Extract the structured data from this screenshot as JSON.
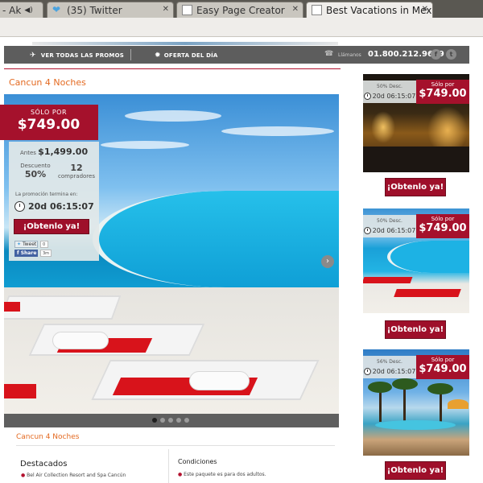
{
  "browser": {
    "tabs": [
      {
        "label": "- Ak",
        "icon": "speaker-icon"
      },
      {
        "label": "(35) Twitter",
        "icon": "twitter-icon"
      },
      {
        "label": "Easy Page Creator",
        "icon": "page-icon"
      },
      {
        "label": "Best Vacations in Mex",
        "icon": "page-icon"
      }
    ]
  },
  "nav": {
    "promos": "VER TODAS LAS PROMOS",
    "deal": "OFERTA DEL DÍA",
    "call_label": "Llámanos",
    "phone": "01.800.212.9639",
    "social": [
      "f",
      "t"
    ]
  },
  "main": {
    "title": "Cancun 4 Noches",
    "price_label": "SÓLO POR",
    "price": "$749.00",
    "before_label": "Antes",
    "before_price": "$1,499.00",
    "discount_label": "Descuento",
    "discount": "50%",
    "buyers_count": "12",
    "buyers_label": "compradores",
    "ends_label": "La promoción termina en:",
    "timer": "20d 06:15:07",
    "cta": "¡Obtenlo ya!",
    "tweet": "Tweet",
    "tweet_count": "0",
    "share": "Share",
    "share_count": "3m",
    "subtitle": "Cancun 4 Noches",
    "highlights_title": "Destacados",
    "highlights_text": "Bel Air Collection Resort and Spa Cancún",
    "conditions_title": "Condiciones",
    "conditions_text": "Este paquete es para dos adultos."
  },
  "cards": [
    {
      "discount": "50% Desc.",
      "timer": "20d 06:15:07",
      "price_label": "Sólo por",
      "price": "$749.00",
      "cta": "¡Obtenlo ya!"
    },
    {
      "discount": "50% Desc.",
      "timer": "20d 06:15:07",
      "price_label": "Sólo por",
      "price": "$749.00",
      "cta": "¡Obtenlo ya!"
    },
    {
      "discount": "56% Desc.",
      "timer": "20d 06:15:07",
      "price_label": "Sólo por",
      "price": "$749.00",
      "cta": "¡Obtenlo ya!"
    }
  ],
  "colors": {
    "brand_red": "#a5112c",
    "accent_orange": "#e46a21",
    "nav_gray": "#5d5d5d"
  }
}
